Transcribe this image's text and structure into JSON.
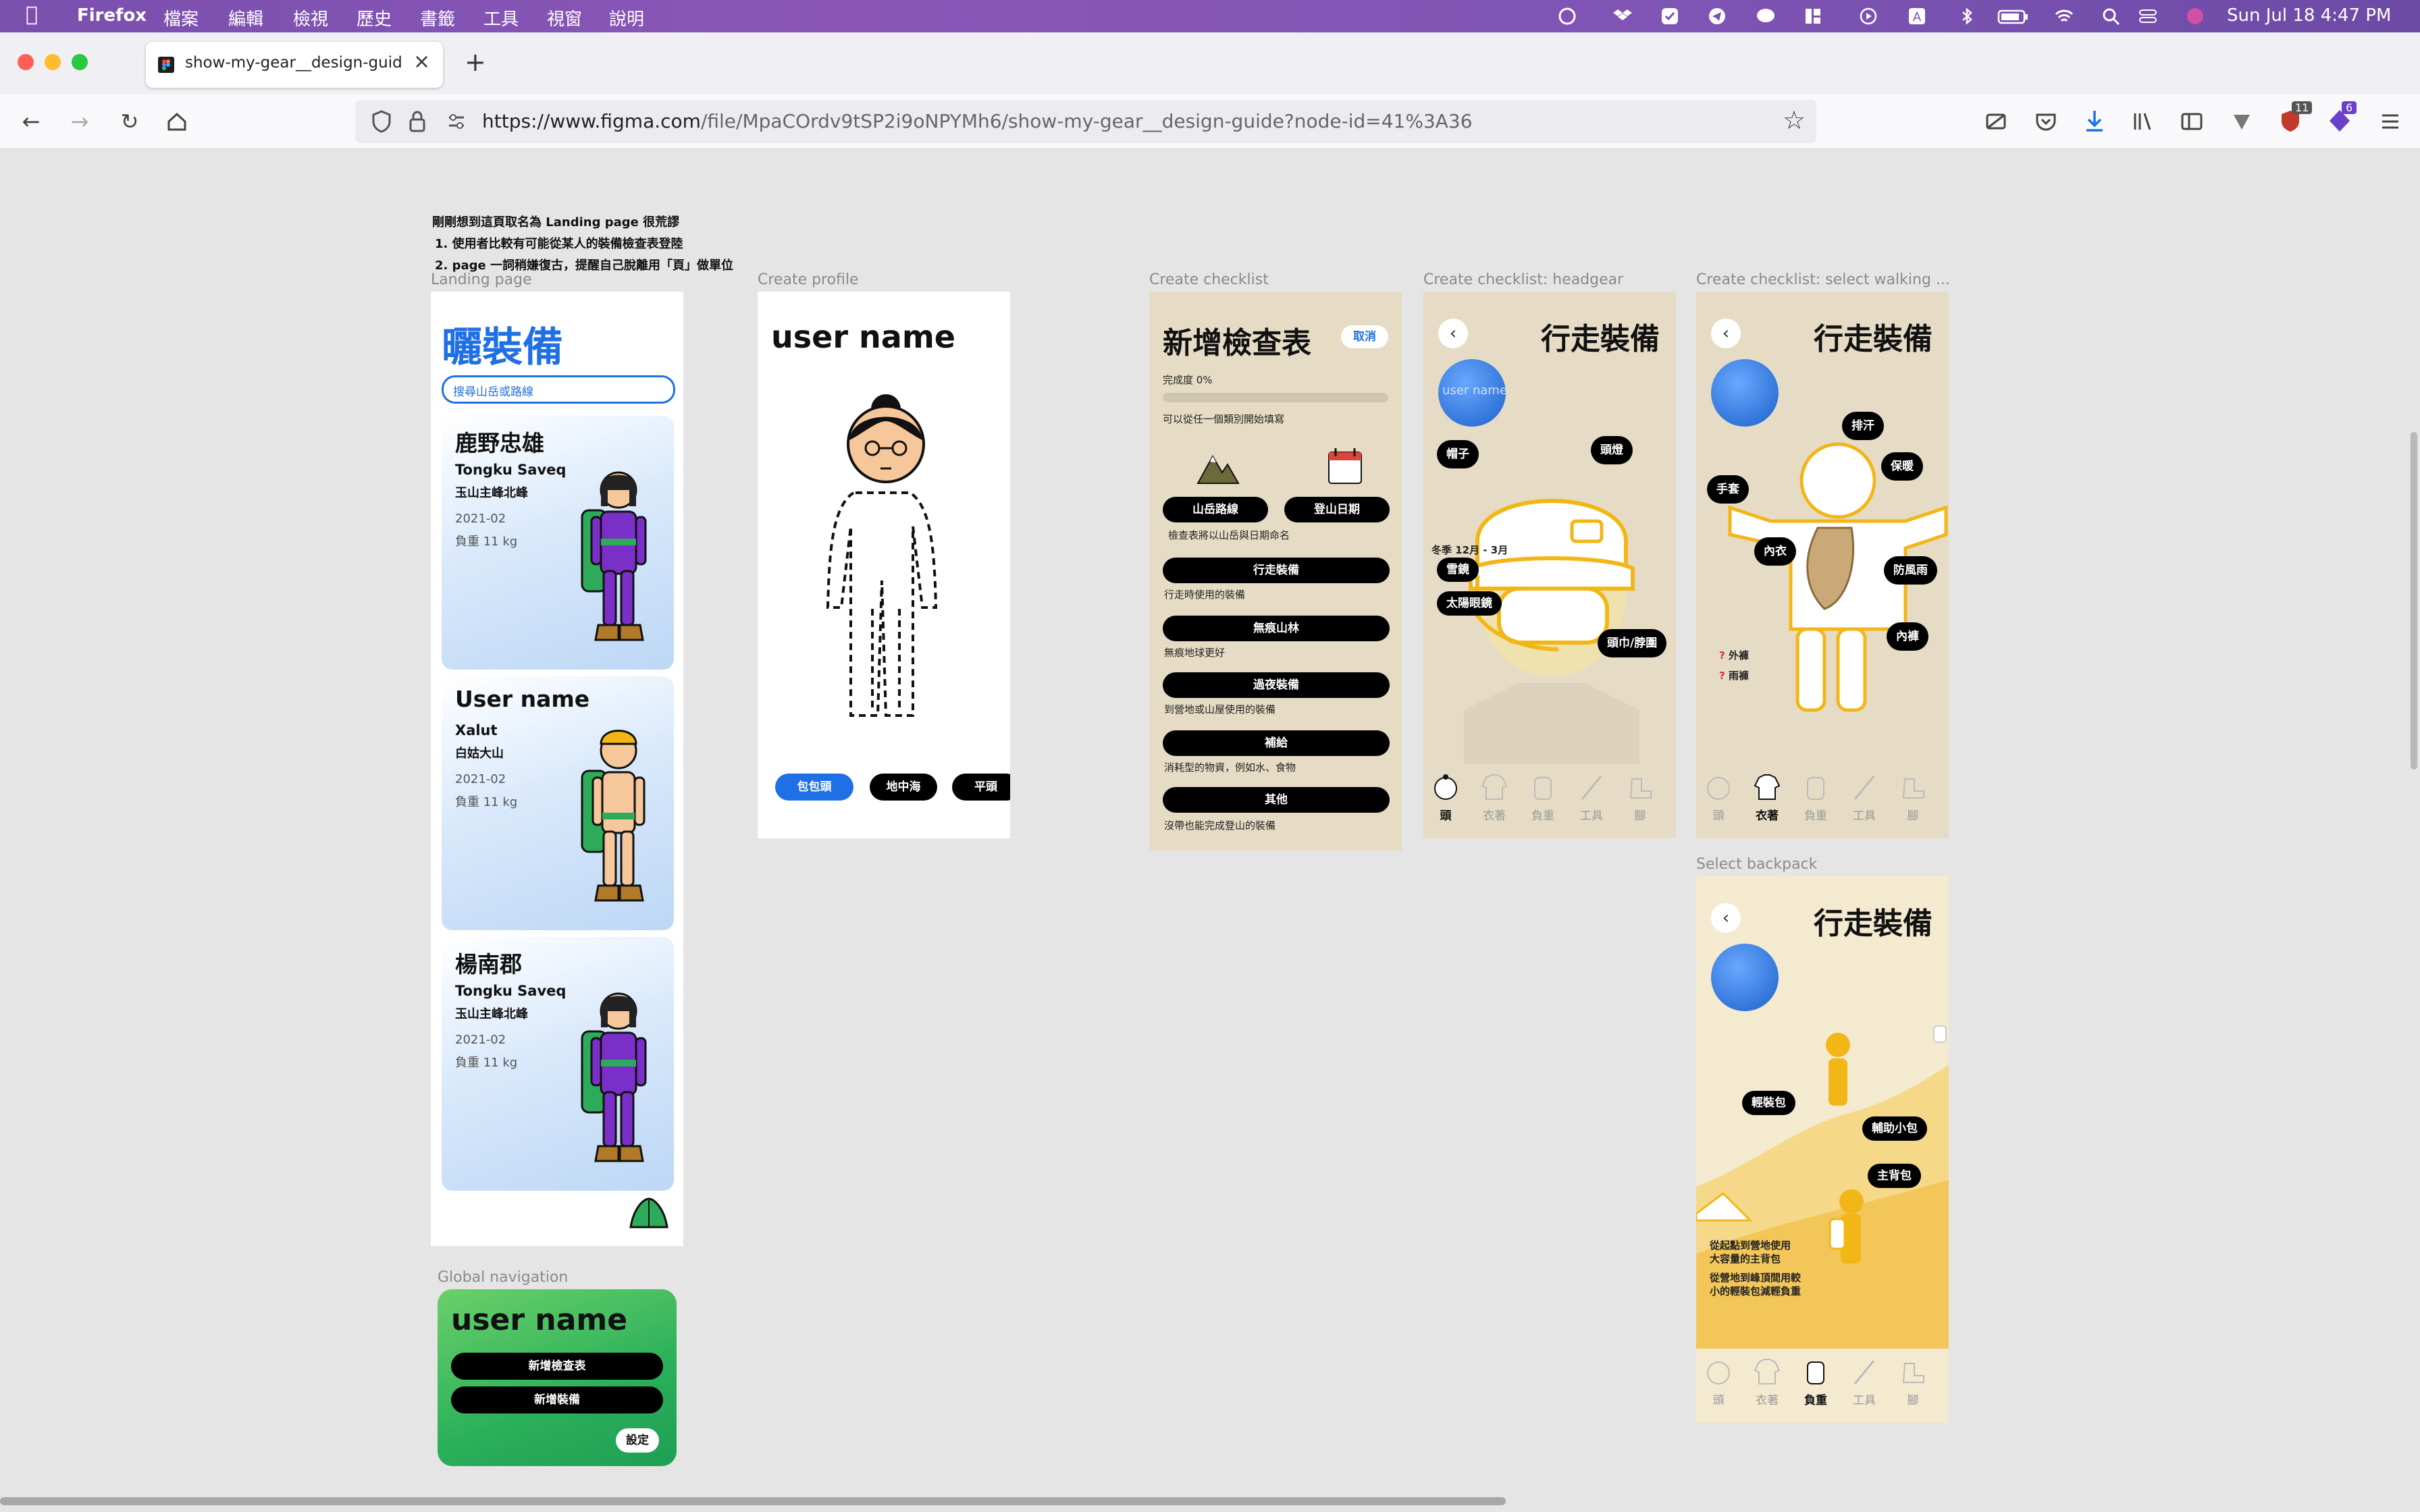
{
  "menubar": {
    "app": "Firefox",
    "menus": [
      "檔案",
      "編輯",
      "檢視",
      "歷史",
      "書籤",
      "工具",
      "視窗",
      "說明"
    ],
    "clock": "Sun Jul 18  4:47 PM"
  },
  "browser": {
    "tab_title": "show-my-gear__design-guide",
    "url_domain": "https://www.figma.com",
    "url_path": "/file/MpaCOrdv9tSP2i9oNPYMh6/show-my-gear__design-guide?node-id=41%3A36",
    "badge_count_1": "11",
    "badge_count_2": "6"
  },
  "note": {
    "line1": "剛剛想到這頁取名為 Landing page 很荒謬",
    "line2": "1. 使用者比較有可能從某人的裝備檢查表登陸",
    "line3": "2. page 一詞稍嫌復古，提醒自己脫離用「頁」做單位"
  },
  "landing": {
    "label": "Landing page",
    "logo": "曬裝備",
    "search_placeholder": "搜尋山岳或路線",
    "cards": [
      {
        "name": "鹿野忠雄",
        "line1": "Tongku Saveq",
        "line2": "玉山主峰北峰",
        "date": "2021-02",
        "load": "負重 11 kg"
      },
      {
        "name": "User name",
        "line1": "Xalut",
        "line2": "白姑大山",
        "date": "2021-02",
        "load": "負重 11 kg"
      },
      {
        "name": "楊南郡",
        "line1": "Tongku Saveq",
        "line2": "玉山主峰北峰",
        "date": "2021-02",
        "load": "負重 11 kg"
      }
    ]
  },
  "profile": {
    "label": "Create profile",
    "username": "user name",
    "hair_options": [
      "包包頭",
      "地中海",
      "平頭"
    ]
  },
  "checklist": {
    "label": "Create checklist",
    "title": "新增檢查表",
    "cancel": "取消",
    "progress_label": "完成度 0%",
    "progress": 0,
    "hint": "可以從任一個類別開始填寫",
    "route_btn": "山岳路線",
    "date_btn": "登山日期",
    "naming_hint": "檢查表將以山岳與日期命名",
    "sections": [
      {
        "btn": "行走裝備",
        "desc": "行走時使用的裝備"
      },
      {
        "btn": "無痕山林",
        "desc": "無痕地球更好"
      },
      {
        "btn": "過夜裝備",
        "desc": "到營地或山屋使用的裝備"
      },
      {
        "btn": "補給",
        "desc": "消耗型的物資，例如水、食物"
      },
      {
        "btn": "其他",
        "desc": "沒帶也能完成登山的裝備"
      }
    ]
  },
  "headgear": {
    "label": "Create checklist: headgear",
    "title": "行走裝備",
    "avatar_text": "user name",
    "chips": {
      "hat": "帽子",
      "lamp": "頭燈",
      "goggles": "雪鏡",
      "sunglasses": "太陽眼鏡",
      "scarf": "頭巾/脖圍"
    },
    "season": "冬季 12月 - 3月",
    "nav": [
      "頭",
      "衣著",
      "負重",
      "工具",
      "腳"
    ],
    "active": 0
  },
  "clothing": {
    "label": "Create checklist: select walking ...",
    "title": "行走裝備",
    "chips": {
      "sweat": "排汗",
      "warm": "保暖",
      "gloves": "手套",
      "underwear": "內衣",
      "windproof": "防風雨",
      "pants": "內褲"
    },
    "extras": [
      "外褲",
      "雨褲"
    ],
    "nav": [
      "頭",
      "衣著",
      "負重",
      "工具",
      "腳"
    ],
    "active": 1
  },
  "backpack": {
    "label": "Select backpack",
    "title": "行走裝備",
    "chips": {
      "light": "輕裝包",
      "aux": "輔助小包",
      "main": "主背包"
    },
    "text1": "從起點到營地使用",
    "text2": "大容量的主背包",
    "text3": "從營地到峰頂間用較",
    "text4": "小的輕裝包減輕負重",
    "nav": [
      "頭",
      "衣著",
      "負重",
      "工具",
      "腳"
    ],
    "active": 2
  },
  "globalnav": {
    "label": "Global navigation",
    "username": "user name",
    "btn1": "新增檢查表",
    "btn2": "新增裝備",
    "settings": "設定"
  },
  "colors": {
    "figma_bg": "#e5e5e5",
    "accent_blue": "#1f6fe6",
    "tan": "#e6dcc5",
    "yellow": "#f3b617",
    "green": "#27b15f"
  }
}
